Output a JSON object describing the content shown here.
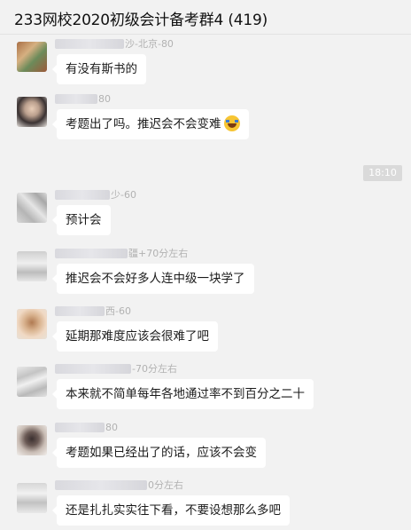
{
  "window": {
    "title": "233网校2020初级会计备考群4 (419)"
  },
  "timestamp": "18:10",
  "messages": [
    {
      "sender_suffix": "沙-北京-80",
      "text": "有没有斯书的",
      "avatar": "avatar-1"
    },
    {
      "sender_suffix": "80",
      "text": "考题出了吗。推迟会不会变难",
      "emoji": "face-with-tears-of-joy-icon",
      "avatar": "avatar-2"
    },
    {
      "sender_suffix": "少-60",
      "text": "预计会",
      "avatar": "avatar-3"
    },
    {
      "sender_suffix": "疆+70分左右",
      "text": "推迟会不会好多人连中级一块学了",
      "avatar": "avatar-4"
    },
    {
      "sender_suffix": "西-60",
      "text": "延期那难度应该会很难了吧",
      "avatar": "avatar-5"
    },
    {
      "sender_suffix": "-70分左右",
      "text": "本来就不简单每年各地通过率不到百分之二十",
      "avatar": "avatar-6"
    },
    {
      "sender_suffix": "80",
      "text": "考题如果已经出了的话，应该不会变",
      "avatar": "avatar-7"
    },
    {
      "sender_suffix": "0分左右",
      "text": "还是扎扎实实往下看，不要设想那么多吧",
      "avatar": "avatar-8"
    }
  ]
}
